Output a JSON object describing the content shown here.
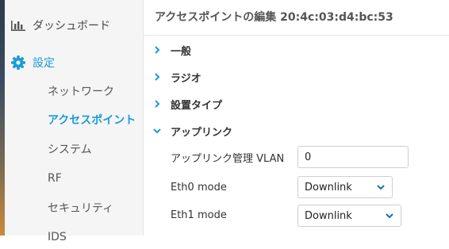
{
  "sidebar": {
    "dashboard": {
      "label": "ダッシュボード",
      "icon": "bar-chart-icon"
    },
    "settings": {
      "label": "設定",
      "icon": "gear-icon"
    },
    "items": [
      {
        "label": "ネットワーク",
        "active": false
      },
      {
        "label": "アクセスポイント",
        "active": true
      },
      {
        "label": "システム",
        "active": false
      },
      {
        "label": "RF",
        "active": false
      },
      {
        "label": "セキュリティ",
        "active": false
      },
      {
        "label": "IDS",
        "active": false
      }
    ]
  },
  "main": {
    "title": "アクセスポイントの編集 20:4c:03:d4:bc:53",
    "sections": [
      {
        "label": "一般",
        "expanded": false
      },
      {
        "label": "ラジオ",
        "expanded": false
      },
      {
        "label": "設置タイプ",
        "expanded": false
      },
      {
        "label": "アップリンク",
        "expanded": true
      }
    ],
    "uplink": {
      "vlan_label": "アップリンク管理 VLAN",
      "vlan_value": "0",
      "eth0_label": "Eth0 mode",
      "eth0_value": "Downlink",
      "eth1_label": "Eth1 mode",
      "eth1_value": "Downlink"
    }
  },
  "colors": {
    "accent": "#1a9bd7",
    "text": "#333333",
    "sidebar_bg": "#f5f5f5"
  }
}
